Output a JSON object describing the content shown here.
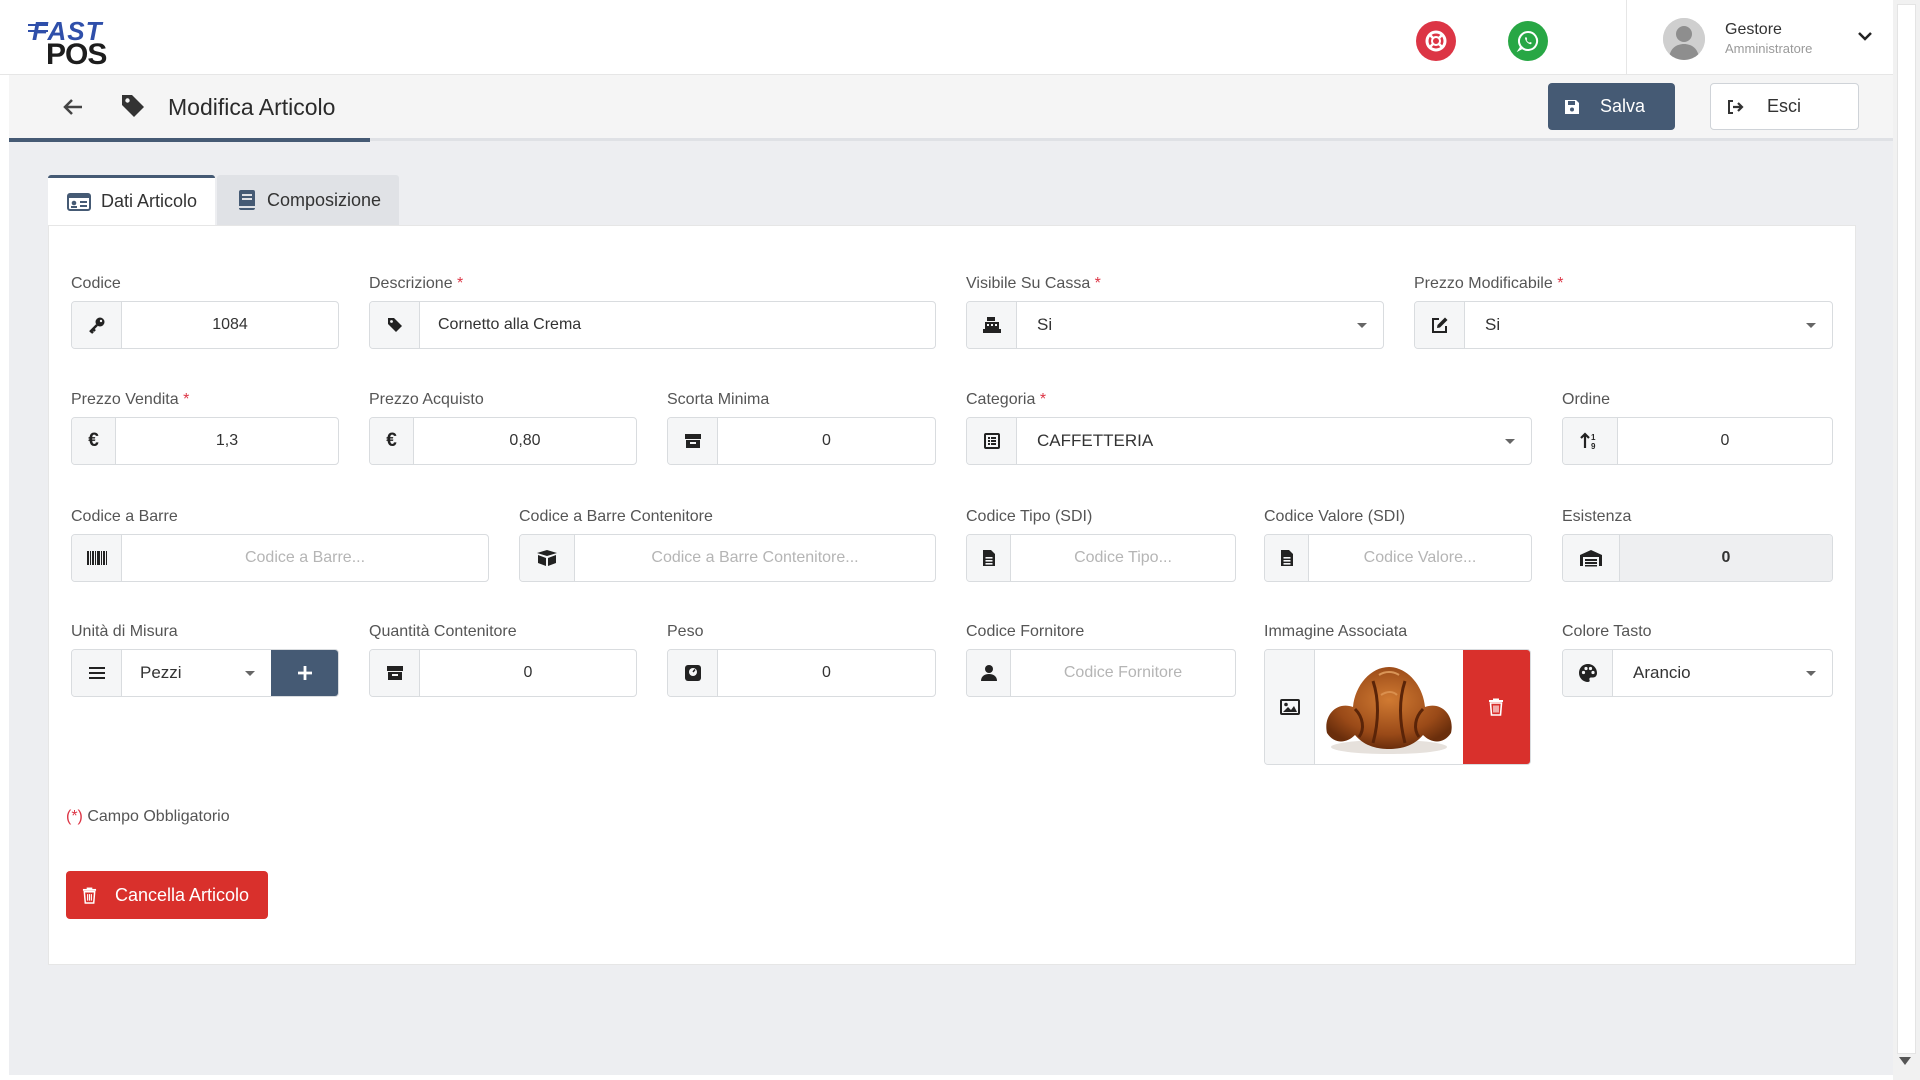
{
  "header": {
    "logo_top": "FAST",
    "logo_bottom": "POS",
    "user_name": "Gestore",
    "user_role": "Amministratore"
  },
  "page": {
    "title": "Modifica Articolo",
    "save_label": "Salva",
    "exit_label": "Esci"
  },
  "tabs": [
    {
      "label": "Dati Articolo",
      "active": true
    },
    {
      "label": "Composizione",
      "active": false
    }
  ],
  "fields": {
    "codice": {
      "label": "Codice",
      "value": "1084"
    },
    "descrizione": {
      "label": "Descrizione",
      "value": "Cornetto alla Crema"
    },
    "visibile_su_cassa": {
      "label": "Visibile Su Cassa",
      "value": "Si"
    },
    "prezzo_modificabile": {
      "label": "Prezzo Modificabile",
      "value": "Si"
    },
    "prezzo_vendita": {
      "label": "Prezzo Vendita",
      "value": "1,3"
    },
    "prezzo_acquisto": {
      "label": "Prezzo Acquisto",
      "value": "0,80"
    },
    "scorta_minima": {
      "label": "Scorta Minima",
      "value": "0"
    },
    "categoria": {
      "label": "Categoria",
      "value": "CAFFETTERIA"
    },
    "ordine": {
      "label": "Ordine",
      "value": "0"
    },
    "codice_barre": {
      "label": "Codice a Barre",
      "placeholder": "Codice a Barre..."
    },
    "codice_barre_contenitore": {
      "label": "Codice a Barre Contenitore",
      "placeholder": "Codice a Barre Contenitore..."
    },
    "codice_tipo": {
      "label": "Codice Tipo (SDI)",
      "placeholder": "Codice Tipo..."
    },
    "codice_valore": {
      "label": "Codice Valore (SDI)",
      "placeholder": "Codice Valore..."
    },
    "esistenza": {
      "label": "Esistenza",
      "value": "0"
    },
    "unita_misura": {
      "label": "Unità di Misura",
      "value": "Pezzi"
    },
    "quantita_contenitore": {
      "label": "Quantità Contenitore",
      "value": "0"
    },
    "peso": {
      "label": "Peso",
      "value": "0"
    },
    "codice_fornitore": {
      "label": "Codice Fornitore",
      "placeholder": "Codice Fornitore"
    },
    "immagine": {
      "label": "Immagine Associata"
    },
    "colore_tasto": {
      "label": "Colore Tasto",
      "value": "Arancio"
    }
  },
  "required_marker": "*",
  "required_note": {
    "marker": "(*)",
    "text": " Campo Obbligatorio"
  },
  "delete_label": "Cancella Articolo",
  "colors": {
    "primary": "#455a74",
    "danger": "#d9302c",
    "whatsapp": "#28a745",
    "help": "#dc3545",
    "background": "#edeef1"
  },
  "icons": [
    "help-lifebuoy-icon",
    "whatsapp-icon",
    "chevron-down-icon",
    "back-arrow-icon",
    "tag-icon",
    "save-icon",
    "exit-icon",
    "id-card-icon",
    "book-icon",
    "key-icon",
    "cash-register-icon",
    "edit-icon",
    "euro-icon",
    "box-icon",
    "list-icon",
    "sort-icon",
    "barcode-icon",
    "boxes-icon",
    "document-icon",
    "warehouse-icon",
    "bars-icon",
    "plus-icon",
    "weight-icon",
    "user-icon",
    "image-icon",
    "trash-icon",
    "palette-icon"
  ]
}
